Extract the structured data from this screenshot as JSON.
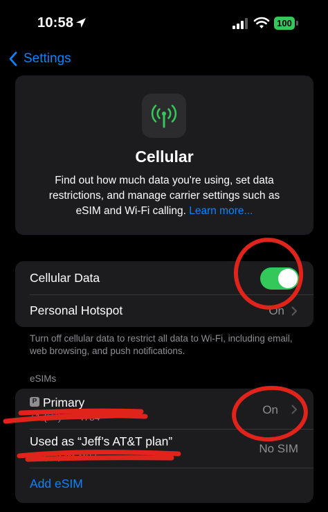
{
  "status_bar": {
    "time": "10:58",
    "battery": "100",
    "icons": [
      "location-arrow-icon",
      "cellular-signal-icon",
      "wifi-icon",
      "battery-icon"
    ]
  },
  "nav": {
    "back_label": "Settings"
  },
  "hero": {
    "icon": "antenna-icon",
    "title": "Cellular",
    "description": "Find out how much data you're using, set data restrictions, and manage carrier settings such as eSIM and Wi-Fi calling.",
    "link": "Learn more..."
  },
  "data_group": {
    "cellular_data": {
      "label": "Cellular Data",
      "enabled": true
    },
    "personal_hotspot": {
      "label": "Personal Hotspot",
      "value": "On"
    }
  },
  "footnote": "Turn off cellular data to restrict all data to Wi-Fi, including email, web browsing, and push notifications.",
  "esims": {
    "header": "eSIMs",
    "primary": {
      "badge": "P",
      "label": "Primary",
      "number": "+1 (***) ***-4784",
      "value": "On"
    },
    "secondary": {
      "label": "Used as “Jeff’s AT&T plan”",
      "number": "+1 (***) ***-**02",
      "value": "No SIM"
    },
    "add_label": "Add eSIM"
  },
  "colors": {
    "accent": "#0a84ff",
    "toggle_on": "#34c759",
    "annotation": "#e0241b"
  }
}
